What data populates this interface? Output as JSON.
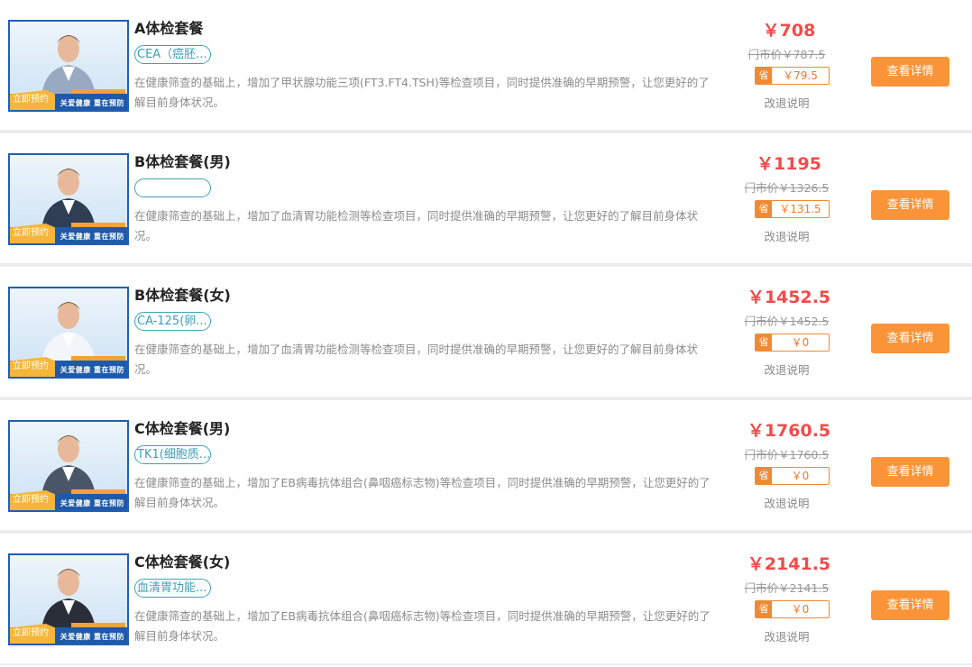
{
  "items": [
    {
      "title": "A体检套餐",
      "tag": "CEA（癌胚...",
      "desc": "在健康筛查的基础上，增加了甲状腺功能三项(FT3.FT4.TSH)等检查项目，同时提供准确的早期预警，让您更好的了解目前身体状况。",
      "price": "￥708",
      "market": "门市价￥787.5",
      "save_label": "省",
      "save": "￥79.5",
      "refund": "改退说明",
      "button": "查看详情",
      "image_book": "立即预约",
      "image_slogan": "关爱健康 重在预防",
      "image_person": "couple"
    },
    {
      "title": "B体检套餐(男)",
      "tag": "",
      "desc": "在健康筛查的基础上，增加了血清胃功能检测等检查项目，同时提供准确的早期预警，让您更好的了解目前身体状况。",
      "price": "￥1195",
      "market": "门市价￥1326.5",
      "save_label": "省",
      "save": "￥131.5",
      "refund": "改退说明",
      "button": "查看详情",
      "image_book": "立即预约",
      "image_slogan": "关爱健康 重在预防",
      "image_person": "man-thumbs-up"
    },
    {
      "title": "B体检套餐(女)",
      "tag": "CA-125(卵...",
      "desc": "在健康筛查的基础上，增加了血清胃功能检测等检查项目，同时提供准确的早期预警，让您更好的了解目前身体状况。",
      "price": "￥1452.5",
      "market": "门市价￥1452.5",
      "save_label": "省",
      "save": "￥0",
      "refund": "改退说明",
      "button": "查看详情",
      "image_book": "立即预约",
      "image_slogan": "关爱健康 重在预防",
      "image_person": "woman-thumbs-up"
    },
    {
      "title": "C体检套餐(男)",
      "tag": "TK1(细胞质...",
      "desc": "在健康筛查的基础上，增加了EB病毒抗体组合(鼻咽癌标志物)等检查项目，同时提供准确的早期预警，让您更好的了解目前身体状况。",
      "price": "￥1760.5",
      "market": "门市价￥1760.5",
      "save_label": "省",
      "save": "￥0",
      "refund": "改退说明",
      "button": "查看详情",
      "image_book": "立即预约",
      "image_slogan": "关爱健康 重在预防",
      "image_person": "businessman"
    },
    {
      "title": "C体检套餐(女)",
      "tag": "血清胃功能...",
      "desc": "在健康筛查的基础上，增加了EB病毒抗体组合(鼻咽癌标志物)等检查项目，同时提供准确的早期预警，让您更好的了解目前身体状况。",
      "price": "￥2141.5",
      "market": "门市价￥2141.5",
      "save_label": "省",
      "save": "￥0",
      "refund": "改退说明",
      "button": "查看详情",
      "image_book": "立即预约",
      "image_slogan": "关爱健康 重在预防",
      "image_person": "businesswoman"
    }
  ],
  "colors": {
    "price": "#f24b4b",
    "button": "#fb9438",
    "tag_border": "#3ea3b8",
    "save_accent": "#ef8a34",
    "image_frame": "#1f5fb5"
  }
}
